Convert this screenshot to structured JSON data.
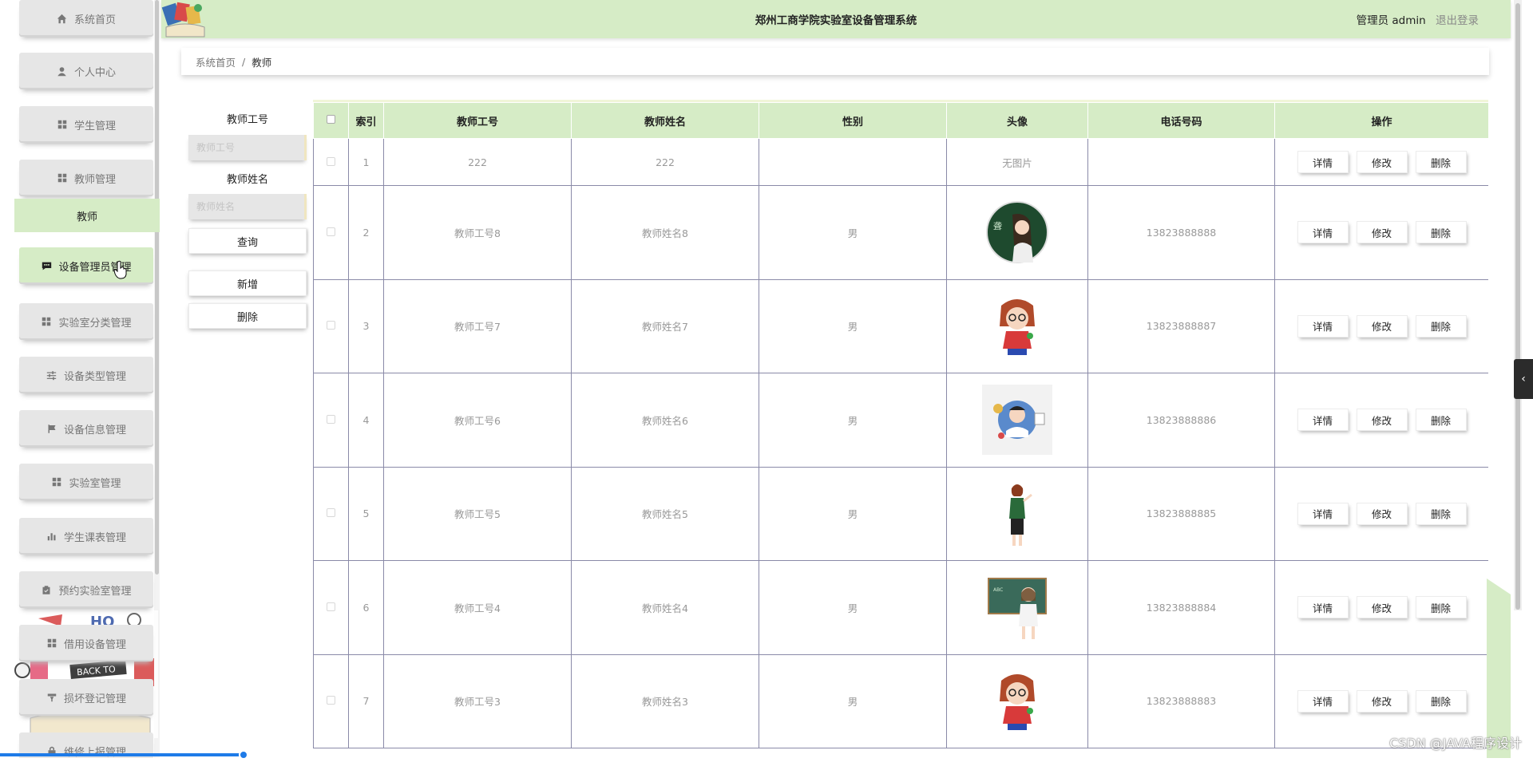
{
  "header": {
    "title": "郑州工商学院实验室设备管理系统",
    "user_role": "管理员",
    "username": "admin",
    "logout_label": "退出登录"
  },
  "sidebar": {
    "items": [
      {
        "label": "系统首页",
        "icon": "home-icon"
      },
      {
        "label": "个人中心",
        "icon": "user-icon"
      },
      {
        "label": "学生管理",
        "icon": "grid-icon"
      },
      {
        "label": "教师管理",
        "icon": "grid-icon"
      },
      {
        "label": "设备管理员管理",
        "icon": "chat-icon"
      },
      {
        "label": "实验室分类管理",
        "icon": "grid-icon"
      },
      {
        "label": "设备类型管理",
        "icon": "sliders-icon"
      },
      {
        "label": "设备信息管理",
        "icon": "flag-icon"
      },
      {
        "label": "实验室管理",
        "icon": "grid-icon"
      },
      {
        "label": "学生课表管理",
        "icon": "bar-chart-icon"
      },
      {
        "label": "预约实验室管理",
        "icon": "clipboard-icon"
      },
      {
        "label": "借用设备管理",
        "icon": "grid-icon"
      },
      {
        "label": "损坏登记管理",
        "icon": "funnel-icon"
      },
      {
        "label": "维修上报管理",
        "icon": "lock-icon"
      }
    ],
    "active_subitem": "教师"
  },
  "breadcrumb": {
    "home": "系统首页",
    "separator": "/",
    "current": "教师"
  },
  "search": {
    "field1_label": "教师工号",
    "field1_placeholder": "教师工号",
    "field2_label": "教师姓名",
    "field2_placeholder": "教师姓名",
    "query_button": "查询",
    "add_button": "新增",
    "delete_button": "删除"
  },
  "table": {
    "headers": [
      "索引",
      "教师工号",
      "教师姓名",
      "性别",
      "头像",
      "电话号码",
      "操作"
    ],
    "no_image_text": "无图片",
    "action_labels": [
      "详情",
      "修改",
      "删除"
    ],
    "rows": [
      {
        "index": "1",
        "id": "222",
        "name": "222",
        "gender": "",
        "avatar": "none",
        "phone": ""
      },
      {
        "index": "2",
        "id": "教师工号8",
        "name": "教师姓名8",
        "gender": "男",
        "avatar": "teacher-chalk-avatar",
        "phone": "13823888888"
      },
      {
        "index": "3",
        "id": "教师工号7",
        "name": "教师姓名7",
        "gender": "男",
        "avatar": "teacher-glasses-avatar",
        "phone": "13823888887"
      },
      {
        "index": "4",
        "id": "教师工号6",
        "name": "教师姓名6",
        "gender": "男",
        "avatar": "teacher-man-avatar",
        "phone": "13823888886"
      },
      {
        "index": "5",
        "id": "教师工号5",
        "name": "教师姓名5",
        "gender": "男",
        "avatar": "teacher-standing-avatar",
        "phone": "13823888885"
      },
      {
        "index": "6",
        "id": "教师工号4",
        "name": "教师姓名4",
        "gender": "男",
        "avatar": "teacher-board-avatar",
        "phone": "13823888884"
      },
      {
        "index": "7",
        "id": "教师工号3",
        "name": "教师姓名3",
        "gender": "男",
        "avatar": "teacher-glasses-avatar",
        "phone": "13823888883"
      }
    ]
  },
  "watermark": "CSDN @JAVA程序设计",
  "colors": {
    "accent_green": "#d6ecc6",
    "menu_gray": "#e6e6e6",
    "table_border": "#8a8aa8"
  }
}
